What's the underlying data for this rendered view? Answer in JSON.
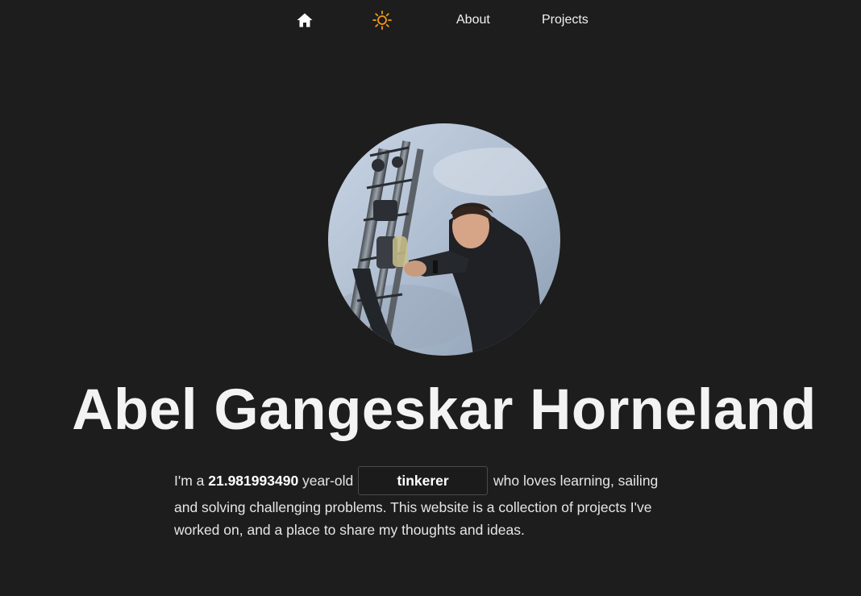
{
  "nav": {
    "home_icon": "home-icon",
    "theme_icon": "sun-icon",
    "theme_color": "#f29a16",
    "links": [
      "About",
      "Projects"
    ]
  },
  "profile": {
    "photo": "profile-photo",
    "name": "Abel Gangeskar Horneland"
  },
  "bio": {
    "prefix": "I'm a ",
    "age": "21.981993490",
    "middle": " year-old",
    "role": "tinkerer",
    "suffix_line1": " who loves learning, sailing",
    "line2": "and solving challenging problems. This website is a collection of projects I've",
    "line3": "worked on, and a place to share my thoughts and ideas."
  },
  "colors": {
    "background": "#1d1d1d",
    "text": "#ececec",
    "accent": "#f29a16"
  }
}
